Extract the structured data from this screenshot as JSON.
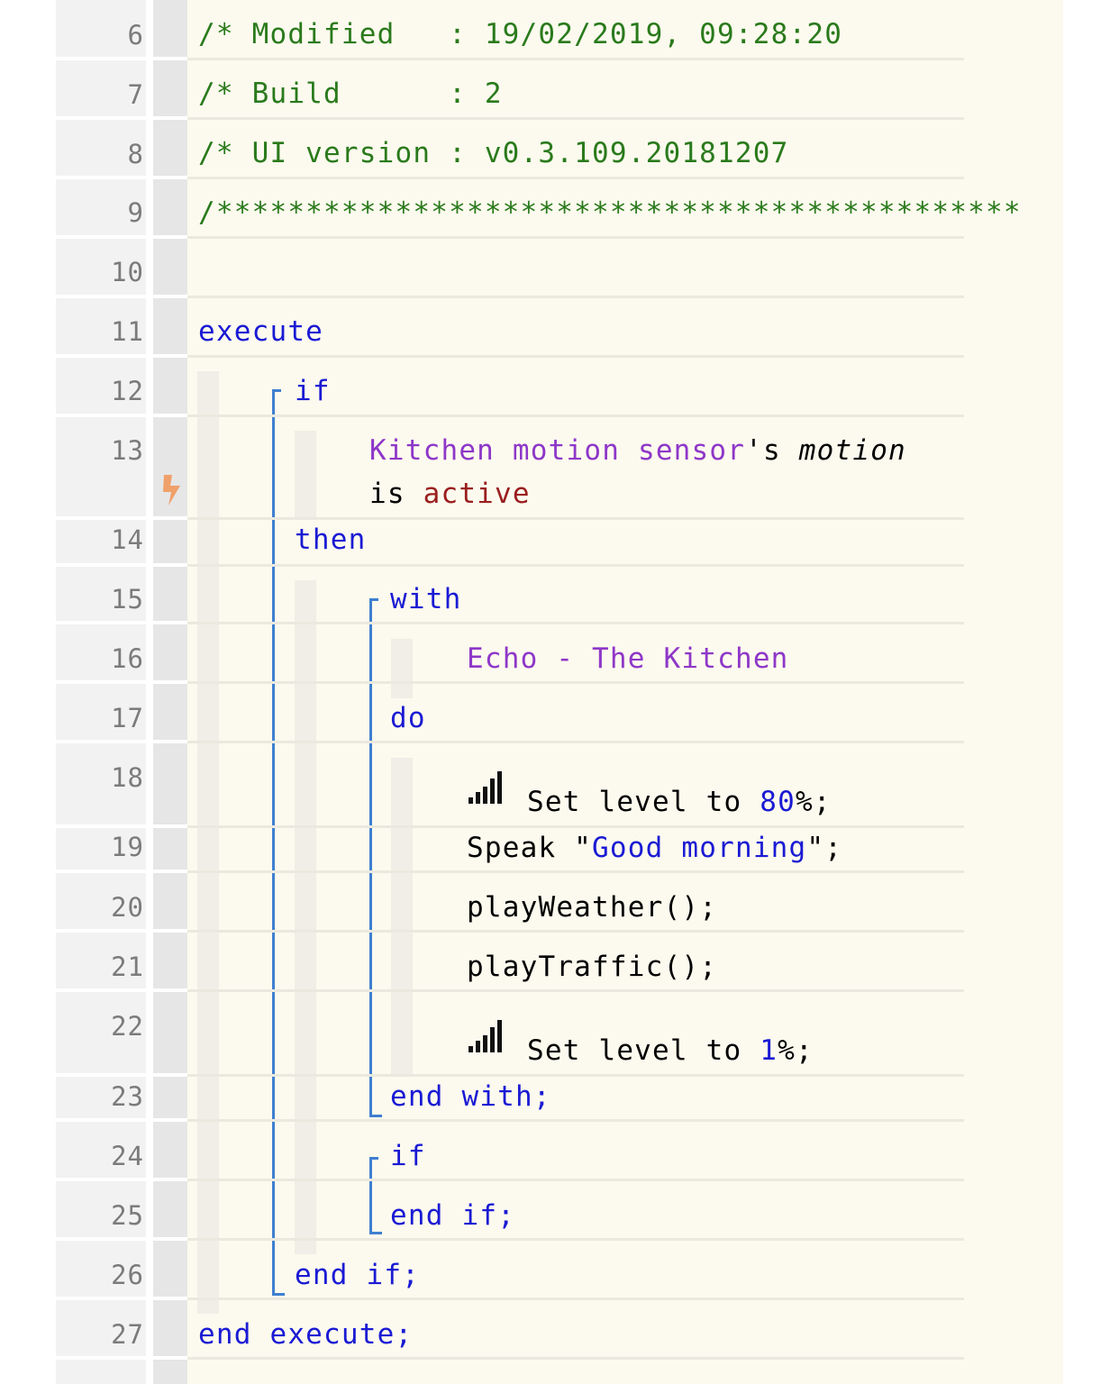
{
  "lines": [
    {
      "n": "6"
    },
    {
      "n": "7"
    },
    {
      "n": "8"
    },
    {
      "n": "9"
    },
    {
      "n": "10"
    },
    {
      "n": "11"
    },
    {
      "n": "12"
    },
    {
      "n": "13"
    },
    {
      "n": "14"
    },
    {
      "n": "15"
    },
    {
      "n": "16"
    },
    {
      "n": "17"
    },
    {
      "n": "18"
    },
    {
      "n": "19"
    },
    {
      "n": "20"
    },
    {
      "n": "21"
    },
    {
      "n": "22"
    },
    {
      "n": "23"
    },
    {
      "n": "24"
    },
    {
      "n": "25"
    },
    {
      "n": "26"
    },
    {
      "n": "27"
    }
  ],
  "header": {
    "modified": "/* Modified   : 19/02/2019, 09:28:20",
    "build": "/* Build      : 2",
    "ui_version": "/* UI version : v0.3.109.20181207",
    "stars": "/*********************************************"
  },
  "code": {
    "execute": "execute",
    "if1": "if",
    "cond_device": "Kitchen motion sensor",
    "cond_poss": "'s ",
    "cond_attr": "motion",
    "cond_is": "is ",
    "cond_value": "active",
    "then": "then",
    "with": "with",
    "with_device": "Echo - The Kitchen",
    "do": "do",
    "set_level_1_pre": "Set level to ",
    "set_level_1_val": "80",
    "set_level_1_post": "%;",
    "speak_pre": "Speak \"",
    "speak_str": "Good morning",
    "speak_post": "\";",
    "play_weather": "playWeather();",
    "play_traffic": "playTraffic();",
    "set_level_2_pre": "Set level to ",
    "set_level_2_val": "1",
    "set_level_2_post": "%;",
    "end_with": "end with;",
    "if2": "if",
    "end_if_inner": "end if;",
    "end_if_outer": "end if;",
    "end_execute": "end execute;"
  },
  "icons": {
    "trigger": "lightning-bolt-icon",
    "level": "signal-level-icon"
  },
  "colors": {
    "comment": "#2a7a1c",
    "keyword": "#1a1ad4",
    "device": "#8e37c9",
    "value": "#9a1e1e",
    "trigger_icon": "#f0a06a",
    "block_line": "#3f7fd0"
  }
}
